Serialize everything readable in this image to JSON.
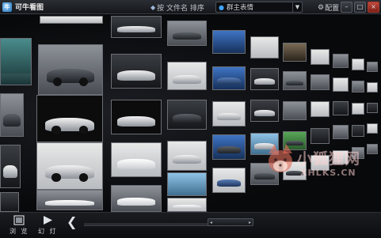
{
  "app": {
    "title": "可牛看图",
    "logo_char": "牛"
  },
  "toolbar": {
    "sort_label": "按 文件名 排序",
    "sort_icon": "sort-arrow-icon",
    "folder_value": "群主表情",
    "config_label": "配置",
    "minimize_glyph": "–",
    "maximize_glyph": "□",
    "close_glyph": "×"
  },
  "bottom": {
    "browse_label": "浏 览",
    "slideshow_label": "幻 灯",
    "prev_glyph": "❮",
    "scroll_left_glyph": "◂",
    "scroll_right_glyph": "▸",
    "slider_progress": 0.0
  },
  "watermark": {
    "text": "小狐狸网",
    "url": "XHLKS.CN"
  },
  "colors": {
    "background": "#0b0c0f",
    "titlebar": "#1f2126",
    "accent": "#3fa3ff",
    "close": "#b3372b"
  }
}
